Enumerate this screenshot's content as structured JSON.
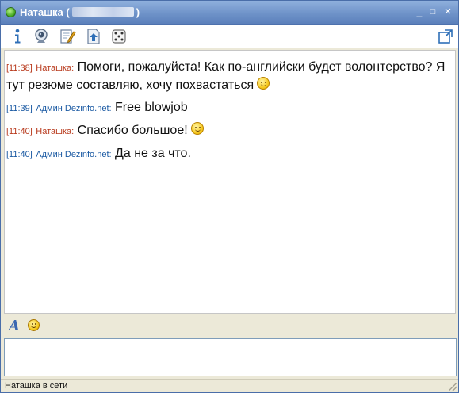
{
  "window": {
    "contact_name": "Наташка",
    "title_open": "(",
    "title_close": ")",
    "minimize_glyph": "_",
    "maximize_glyph": "□",
    "close_glyph": "×"
  },
  "toolbar": {
    "buttons": [
      {
        "name": "info-icon"
      },
      {
        "name": "webcam-icon"
      },
      {
        "name": "notepad-icon"
      },
      {
        "name": "send-file-icon"
      },
      {
        "name": "dice-icon"
      }
    ],
    "detach_icon": "popout-icon"
  },
  "messages": [
    {
      "time": "[11:38]",
      "nick": "Наташка:",
      "text": "Помоги, пожалуйста! Как по-английски будет волонтерство? Я тут резюме составляю, хочу похвастаться",
      "emoticon": "smile"
    },
    {
      "time": "[11:39]",
      "nick": "Админ Dezinfo.net:",
      "text": "Free blowjob",
      "emoticon": ""
    },
    {
      "time": "[11:40]",
      "nick": "Наташка:",
      "text": "Спасибо большое!",
      "emoticon": "tongue"
    },
    {
      "time": "[11:40]",
      "nick": "Админ Dezinfo.net:",
      "text": "Да не за что.",
      "emoticon": ""
    }
  ],
  "input_toolbar": {
    "format_glyph": "A"
  },
  "input": {
    "value": "",
    "placeholder": ""
  },
  "status": {
    "text": "Наташка в сети"
  },
  "colors": {
    "incoming_nick": "#b83a1d",
    "outgoing_nick": "#1b5aa3",
    "titlebar": "#6f93c9"
  }
}
